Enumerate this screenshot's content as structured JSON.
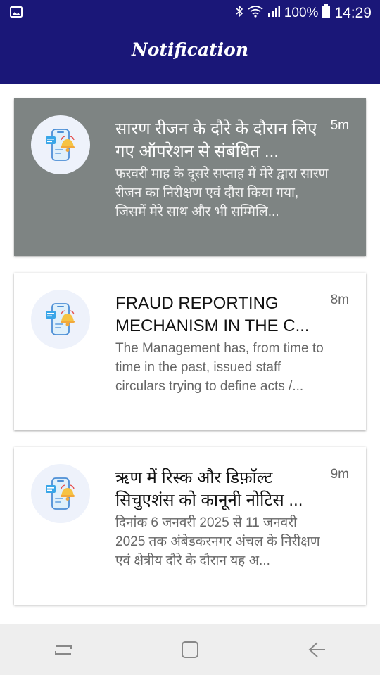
{
  "status_bar": {
    "battery": "100%",
    "time": "14:29",
    "icons": [
      "image-icon",
      "bluetooth-icon",
      "wifi-icon",
      "signal-icon",
      "battery-icon"
    ]
  },
  "app_bar": {
    "title": "Notification"
  },
  "notifications": [
    {
      "title": "सारण रीजन के दौरे के दौरान लिए गए ऑपरेशन से संबंधित ...",
      "time": "5m",
      "body": "फरवरी माह के दूसरे सप्ताह में मेरे द्वारा सारण रीजन का निरीक्षण एवं दौरा किया गया, जिसमें मेरे साथ और  भी सम्मिलि...",
      "selected": true
    },
    {
      "title": "FRAUD REPORTING MECHANISM IN THE C...",
      "time": "8m",
      "body": "The Management has, from time to time in the past, issued staff circulars trying to define acts /...",
      "selected": false
    },
    {
      "title": "ऋण में रिस्क और डिफ़ॉल्ट सिचुएशंस को कानूनी नोटिस ...",
      "time": "9m",
      "body": "दिनांक 6 जनवरी 2025 से 11 जनवरी 2025 तक अंबेडकरनगर अंचल के निरीक्षण एवं क्षेत्रीय दौरे के दौरान यह अ...",
      "selected": false
    }
  ],
  "nav_bar": {
    "icons": [
      "recent-apps-icon",
      "home-icon",
      "back-icon"
    ]
  },
  "colors": {
    "primary": "#1a1778",
    "selected_card": "#7e8483",
    "icon_circle": "#eef2fb"
  }
}
